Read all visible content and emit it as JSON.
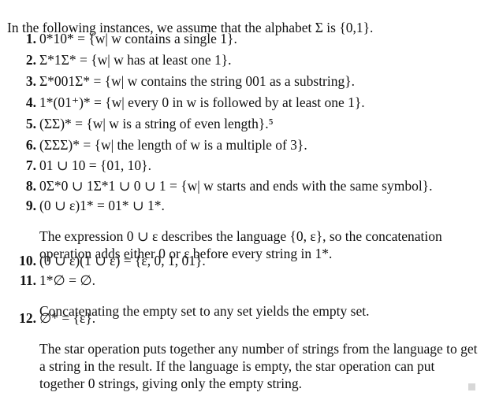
{
  "intro": "In the following instances, we assume that the alphabet Σ is {0,1}.",
  "examples": [
    {
      "num": "1.",
      "expr": "0*10* = {w| w contains a single 1}."
    },
    {
      "num": "2.",
      "expr": "Σ*1Σ* = {w| w has at least one 1}."
    },
    {
      "num": "3.",
      "expr": "Σ*001Σ* = {w| w contains the string 001 as a substring}."
    },
    {
      "num": "4.",
      "expr": "1*(01⁺)* = {w| every 0 in w is followed by at least one 1}."
    },
    {
      "num": "5.",
      "expr": "(ΣΣ)* = {w| w is a string of even length}.⁵"
    },
    {
      "num": "6.",
      "expr": "(ΣΣΣ)* = {w| the length of w is a multiple of 3}."
    },
    {
      "num": "7.",
      "expr": "01 ∪ 10 = {01, 10}."
    },
    {
      "num": "8.",
      "expr": "0Σ*0 ∪ 1Σ*1 ∪ 0 ∪ 1 = {w| w starts and ends with the same symbol}."
    },
    {
      "num": "9.",
      "expr": "(0 ∪ ε)1* = 01* ∪ 1*.",
      "note": "The expression 0 ∪ ε describes the language {0, ε}, so the concatenation operation adds either 0 or ε before every string in 1*."
    },
    {
      "num": "10.",
      "expr": "(0 ∪ ε)(1 ∪ ε) = {ε, 0, 1, 01}."
    },
    {
      "num": "11.",
      "expr": "1*∅ = ∅.",
      "note": "Concatenating the empty set to any set yields the empty set."
    },
    {
      "num": "12.",
      "expr": "∅* = {ε}.",
      "note": "The star operation puts together any number of strings from the language to get a string in the result. If the language is empty, the star operation can put together 0 strings, giving only the empty string."
    }
  ]
}
